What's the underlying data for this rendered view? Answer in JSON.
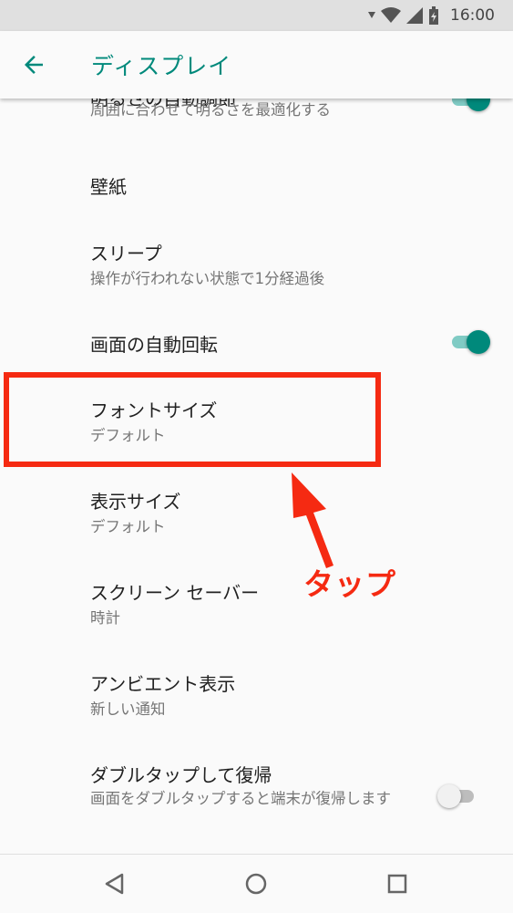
{
  "status_bar": {
    "time": "16:00",
    "icons": [
      "signal-icon",
      "wifi-icon",
      "cell-signal-icon",
      "battery-icon"
    ]
  },
  "app_bar": {
    "title": "ディスプレイ",
    "back_icon": "arrow-back-icon"
  },
  "settings": [
    {
      "title": "明るさの自動調節",
      "summary": "周囲に合わせて明るさを最適化する",
      "toggle": "on"
    },
    {
      "title": "壁紙"
    },
    {
      "title": "スリープ",
      "summary": "操作が行われない状態で1分経過後"
    },
    {
      "title": "画面の自動回転",
      "toggle": "on"
    },
    {
      "title": "フォントサイズ",
      "summary": "デフォルト"
    },
    {
      "title": "表示サイズ",
      "summary": "デフォルト"
    },
    {
      "title": "スクリーン セーバー",
      "summary": "時計"
    },
    {
      "title": "アンビエント表示",
      "summary": "新しい通知"
    },
    {
      "title": "ダブルタップして復帰",
      "summary": "画面をダブルタップすると端末が復帰します",
      "toggle": "off"
    }
  ],
  "annotation": {
    "label": "タップ",
    "color": "#f52a12"
  },
  "nav_bar": {
    "buttons": [
      "back-triangle-icon",
      "home-circle-icon",
      "recents-square-icon"
    ]
  },
  "colors": {
    "accent": "#00897b",
    "accent_light": "#80cbc4",
    "annotation": "#f52a12"
  }
}
